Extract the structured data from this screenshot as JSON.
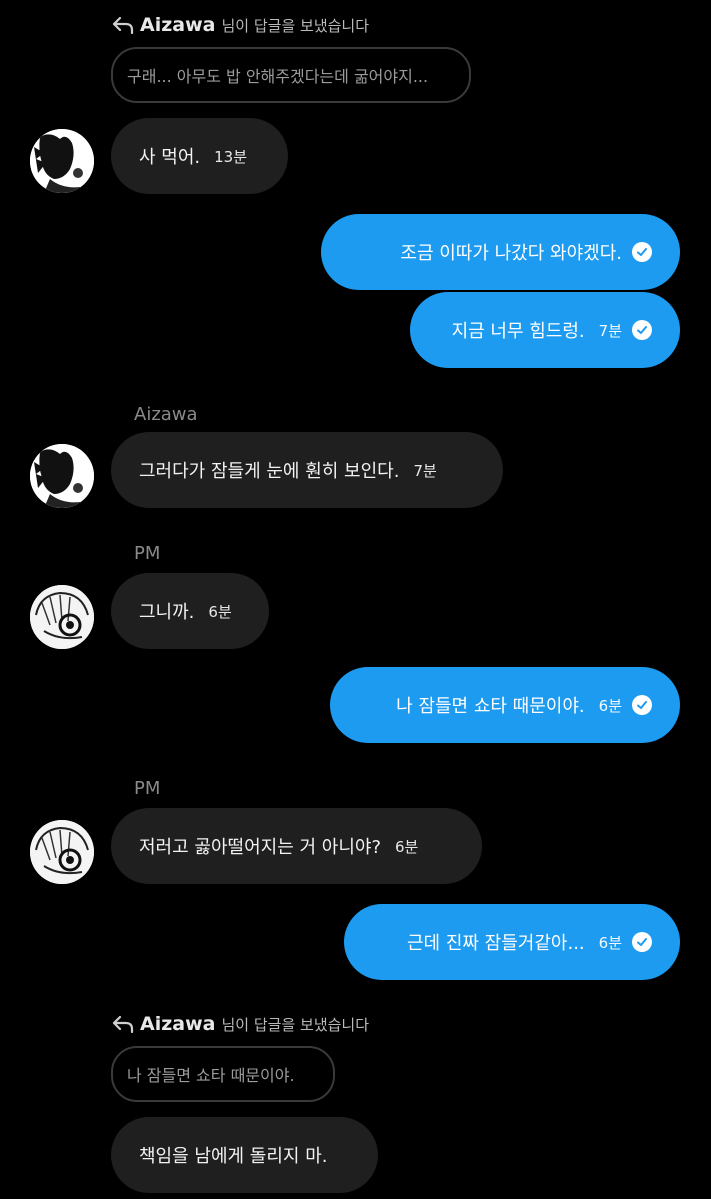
{
  "reply1": {
    "name": "Aizawa",
    "suffix": "님이 답글을 보냈습니다",
    "quote": "구래... 아무도 밥 안해주겠다는데 굶어야지..."
  },
  "msgs": {
    "m1": {
      "text": "사 먹어.",
      "time": "13분"
    },
    "m2": {
      "text": "조금 이따가 나갔다 와야겠다."
    },
    "m3": {
      "text": "지금 너무 힘드렁.",
      "time": "7분"
    },
    "s1": "Aizawa",
    "m4": {
      "text": "그러다가 잠들게 눈에 훤히 보인다.",
      "time": "7분"
    },
    "s2": "PM",
    "m5": {
      "text": "그니까.",
      "time": "6분"
    },
    "m6": {
      "text": "나 잠들면 쇼타 때문이야.",
      "time": "6분"
    },
    "s3": "PM",
    "m7": {
      "text": "저러고 곯아떨어지는 거 아니야?",
      "time": "6분"
    },
    "m8": {
      "text": "근데 진짜 잠들거같아...",
      "time": "6분"
    }
  },
  "reply2": {
    "name": "Aizawa",
    "suffix": "님이 답글을 보냈습니다",
    "quote": "나 잠들면 쇼타 때문이야."
  },
  "m9": {
    "text": "책임을 남에게 돌리지 마."
  },
  "icons": {
    "reply": "reply-arrow-icon",
    "read": "read-check-icon"
  },
  "colors": {
    "outgoing": "#1d9bf0",
    "incoming": "#1f1f1f",
    "background": "#000000"
  }
}
